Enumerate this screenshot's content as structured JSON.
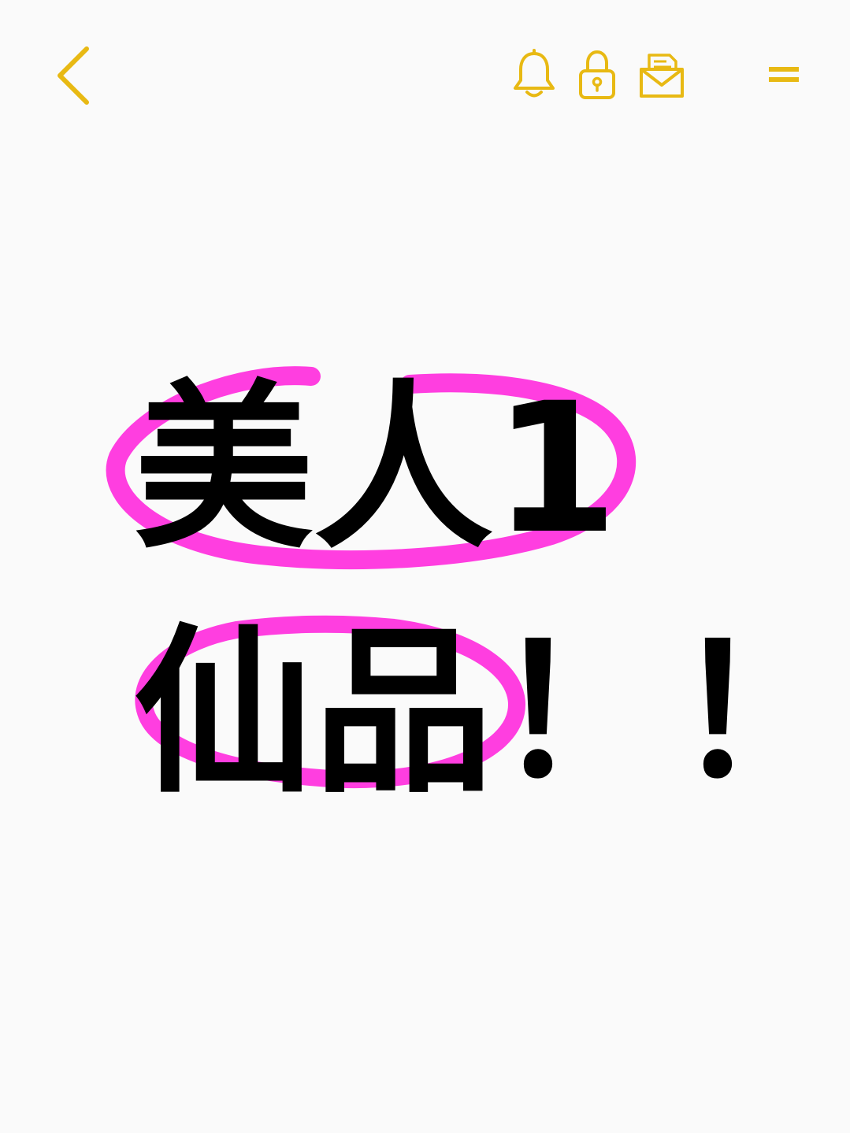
{
  "toolbar": {
    "accent_color": "#e8b913",
    "back_icon": "chevron-left-icon",
    "actions": [
      {
        "icon": "bell-icon"
      },
      {
        "icon": "lock-icon"
      },
      {
        "icon": "mail-icon"
      },
      {
        "icon": "menu-icon"
      }
    ]
  },
  "note": {
    "line1": "美人1",
    "line2": "仙品！！"
  },
  "highlight_color": "#ff3ee0",
  "background_color": "#fafafa",
  "text_color": "#000000"
}
